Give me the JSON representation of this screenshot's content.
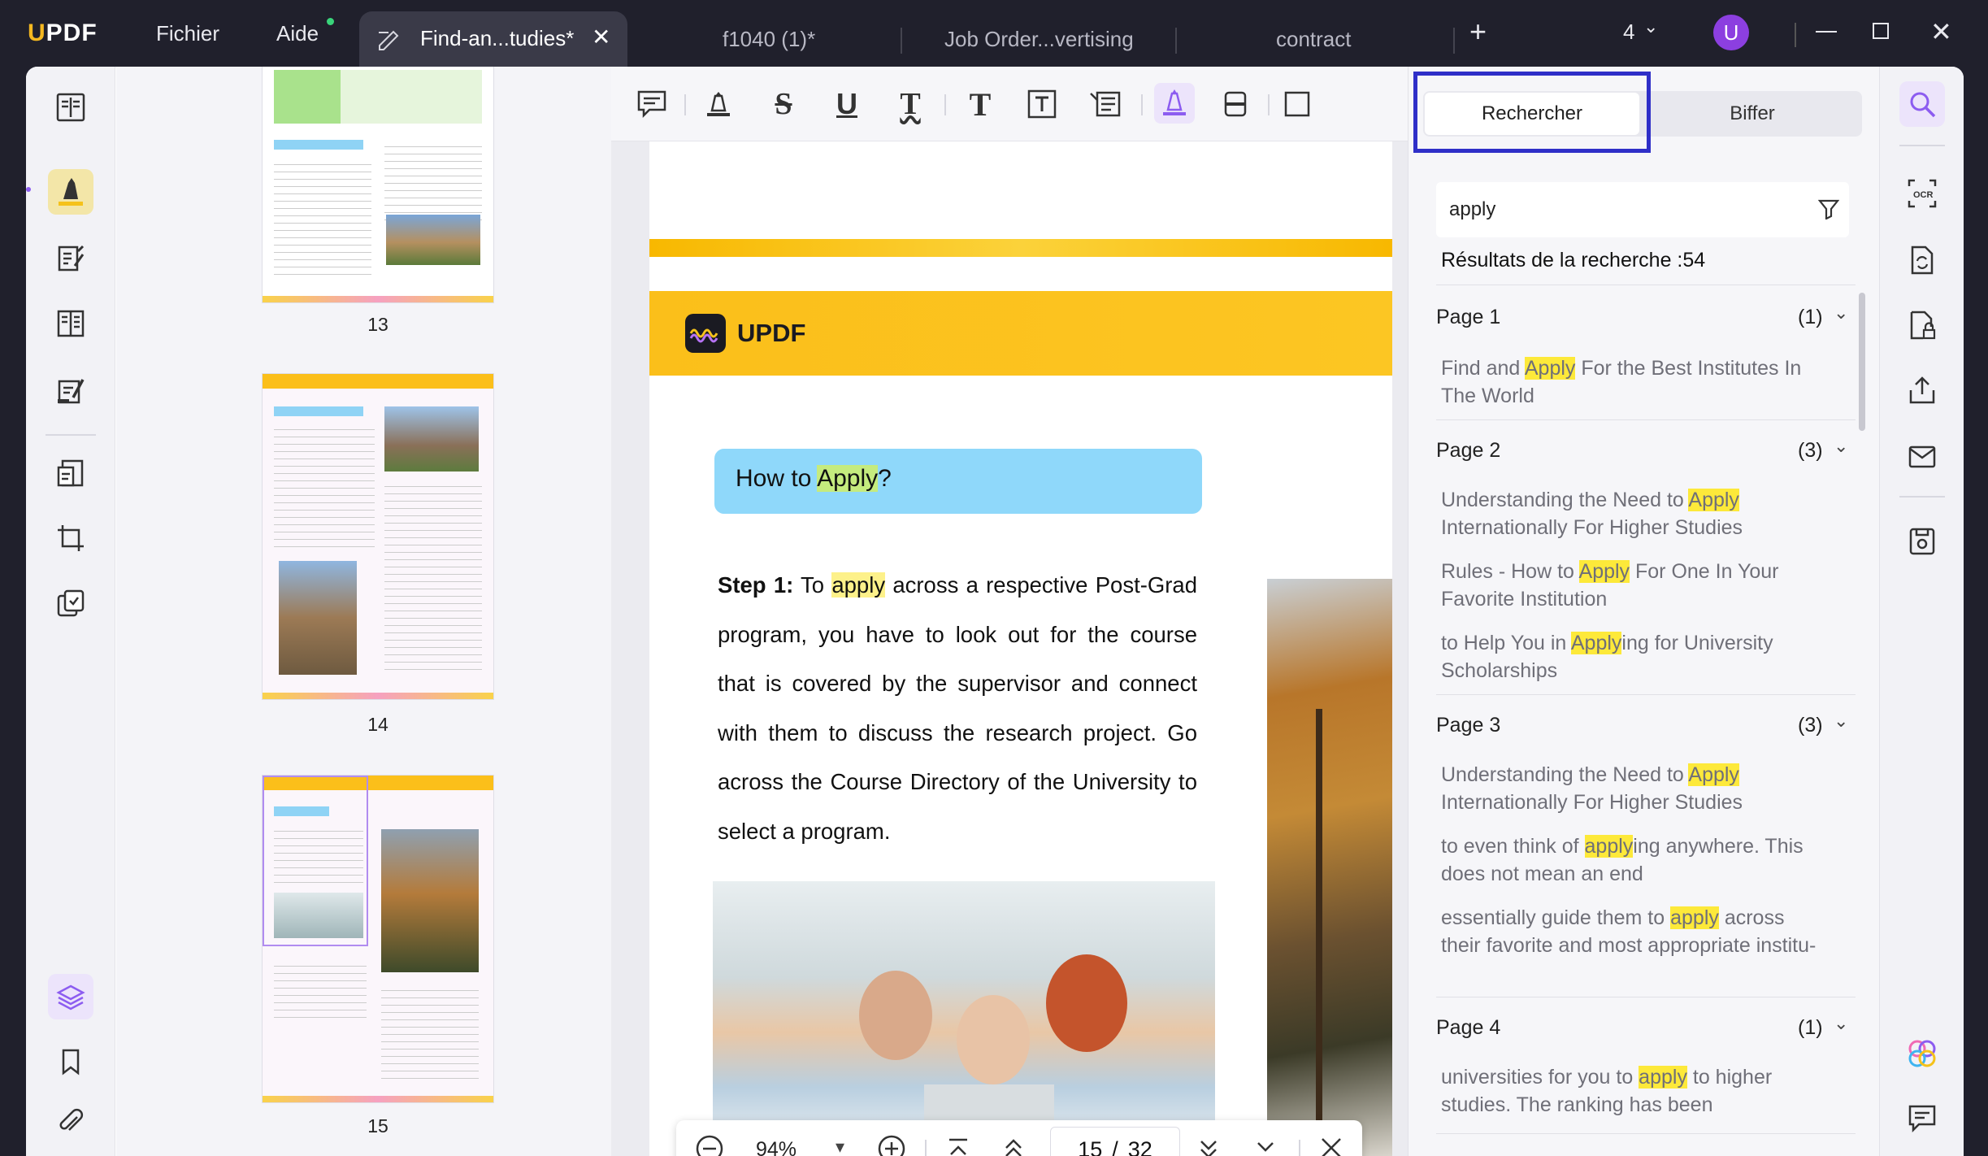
{
  "titlebar": {
    "logo": "UPDF",
    "menu": [
      "Fichier",
      "Aide"
    ],
    "tabs": [
      {
        "label": "Find-an...tudies*",
        "active": true
      },
      {
        "label": "f1040 (1)*",
        "active": false
      },
      {
        "label": "Job Order...vertising",
        "active": false
      },
      {
        "label": "contract",
        "active": false
      }
    ],
    "add_tab": "+",
    "window_count": "4",
    "user_initial": "U"
  },
  "thumbnails": [
    {
      "page": "13"
    },
    {
      "page": "14"
    },
    {
      "page": "15"
    }
  ],
  "document": {
    "brand": "UPDF",
    "heading_pre": "How to ",
    "heading_hl": "Apply",
    "heading_post": "?",
    "step_label": "Step 1:",
    "step_pre": " To ",
    "step_hl": "apply",
    "step_post": " across a respective Post-Grad program, you have to look out for the course that is covered by the supervisor and connect with them to discuss the research project. Go across the Course Directory of the University to select a program."
  },
  "navigator": {
    "zoom": "94%",
    "current_page": "15",
    "separator": "/",
    "total_pages": "32"
  },
  "search_panel": {
    "tab_search": "Rechercher",
    "tab_strike": "Biffer",
    "query": "apply",
    "results_label": "Résultats de la recherche :54",
    "groups": [
      {
        "page": "Page 1",
        "count": "(1)",
        "items": [
          {
            "pre": "Find and ",
            "hl": "Apply",
            "post": " For the Best Institutes In The World"
          }
        ]
      },
      {
        "page": "Page 2",
        "count": "(3)",
        "items": [
          {
            "pre": "Understanding the Need to ",
            "hl": "Apply",
            "post": " Internationally For Higher Studies"
          },
          {
            "pre": "Rules - How to ",
            "hl": "Apply",
            "post": " For One In Your Favorite Institution"
          },
          {
            "pre": "to Help You in ",
            "hl": "Apply",
            "post": "ing for University Scholarships"
          }
        ]
      },
      {
        "page": "Page 3",
        "count": "(3)",
        "items": [
          {
            "pre": "Understanding the Need to ",
            "hl": "Apply",
            "post": " Internationally For Higher Studies"
          },
          {
            "pre": "to even think of ",
            "hl": "apply",
            "post": "ing anywhere. This does not mean an end"
          },
          {
            "pre": "essentially guide them to ",
            "hl": "apply",
            "post": " across their favorite and most appropriate institu-"
          }
        ]
      },
      {
        "page": "Page 4",
        "count": "(1)",
        "items": [
          {
            "pre": "universities for you to ",
            "hl": "apply",
            "post": " to higher studies. The ranking has been"
          }
        ]
      }
    ]
  },
  "colors": {
    "accent": "#8c5cf0",
    "highlight": "#fde93a",
    "focus_box": "#2f2fc8",
    "banner": "#fbbf1a"
  }
}
